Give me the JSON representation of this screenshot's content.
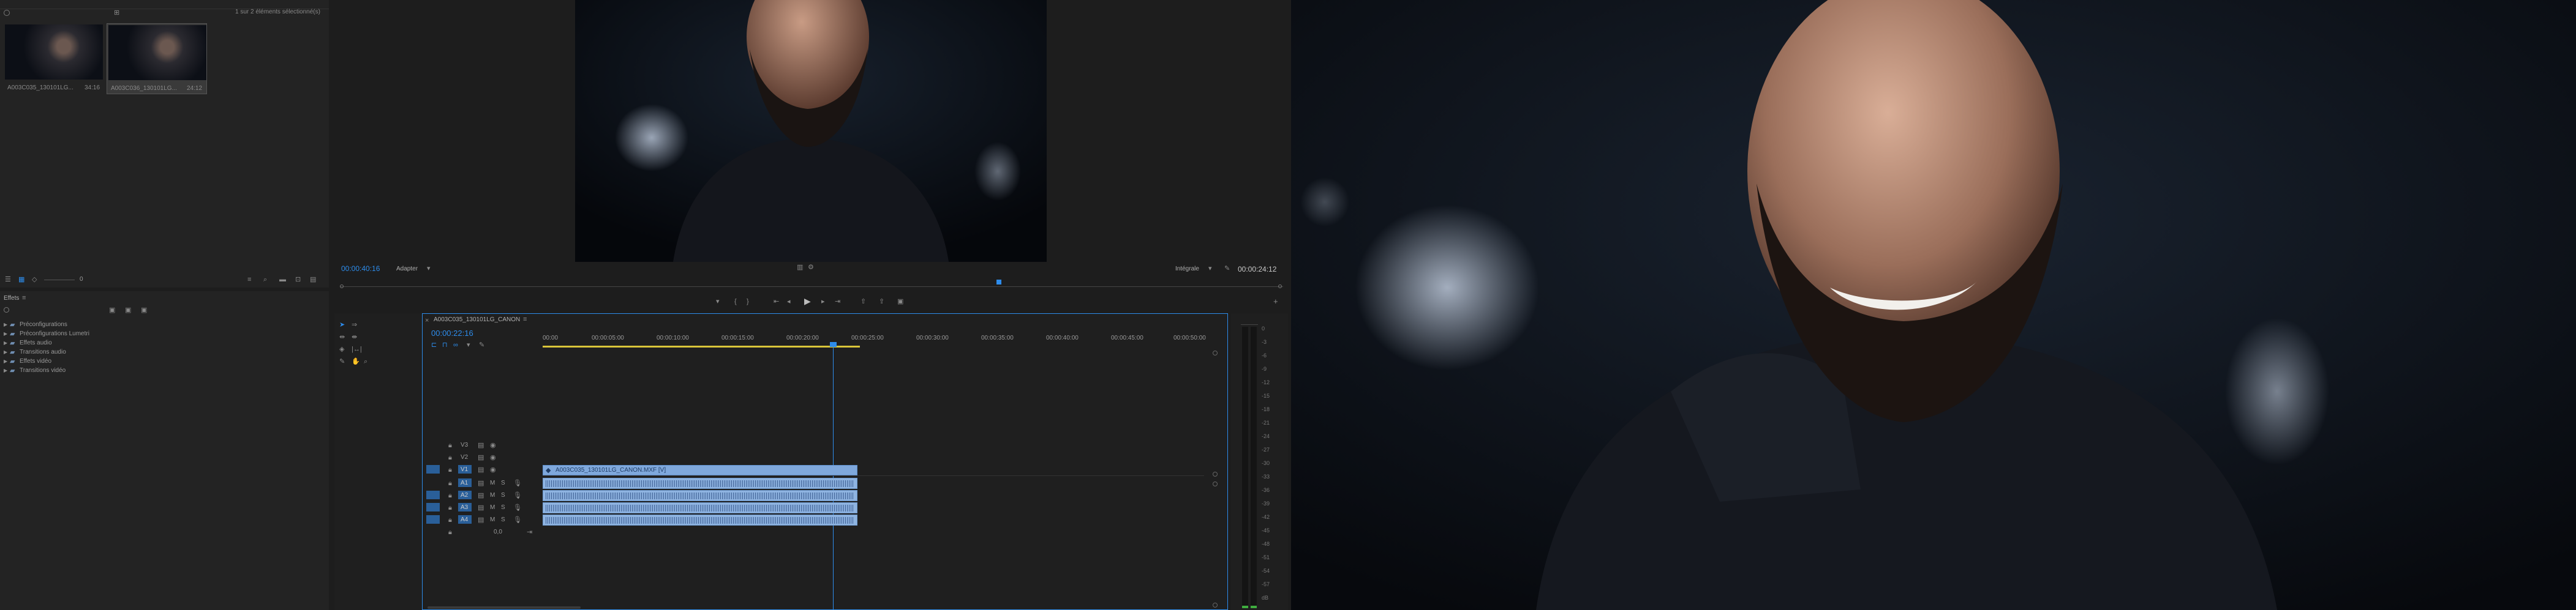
{
  "project": {
    "search_placeholder": "",
    "selection_status": "1 sur 2 éléments sélectionné(s)",
    "items": [
      {
        "name": "A003C035_130101LG...",
        "duration": "34:16"
      },
      {
        "name": "A003C036_130101LG...",
        "duration": "24:12"
      }
    ],
    "zoom_value": "0"
  },
  "effects": {
    "tab_label": "Effets",
    "folders": [
      "Préconfigurations",
      "Préconfigurations Lumetri",
      "Effets audio",
      "Transitions audio",
      "Effets vidéo",
      "Transitions vidéo"
    ]
  },
  "program": {
    "timecode_current": "00:00:40:16",
    "fit_label": "Adapter",
    "quality_label": "Intégrale",
    "timecode_duration": "00:00:24:12"
  },
  "timeline": {
    "sequence_name": "A003C035_130101LG_CANON",
    "timecode": "00:00:22:16",
    "ruler_labels": [
      "00:00",
      "00:00:05:00",
      "00:00:10:00",
      "00:00:15:00",
      "00:00:20:00",
      "00:00:25:00",
      "00:00:30:00",
      "00:00:35:00",
      "00:00:40:00",
      "00:00:45:00",
      "00:00:50:00"
    ],
    "video_tracks": [
      "V3",
      "V2",
      "V1"
    ],
    "audio_tracks": [
      "A1",
      "A2",
      "A3",
      "A4"
    ],
    "clip_label": "A003C035_130101LG_CANON.MXF [V]",
    "master_value": "0,0",
    "playhead_fraction": 0.4
  },
  "meters": {
    "scale": [
      "0",
      "-3",
      "-6",
      "-9",
      "-12",
      "-15",
      "-18",
      "-21",
      "-24",
      "-27",
      "-30",
      "-33",
      "-36",
      "-39",
      "-42",
      "-45",
      "-48",
      "-51",
      "-54",
      "-57",
      "dB"
    ]
  },
  "colors": {
    "accent": "#2d8ceb",
    "clip_audio": "#8eb3e0",
    "clip_video": "#7fa8dc",
    "background": "#1d1d1d"
  }
}
